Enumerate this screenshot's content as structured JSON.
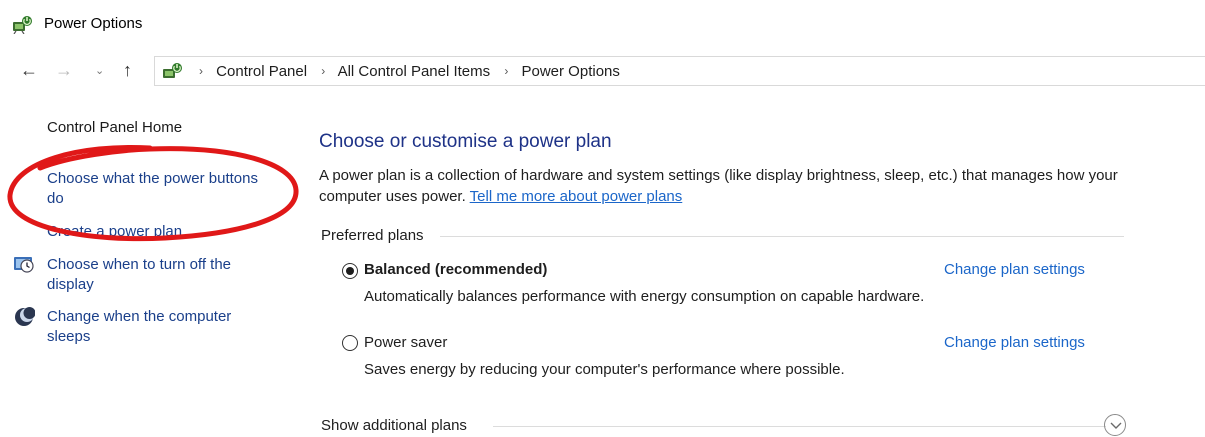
{
  "window": {
    "title": "Power Options",
    "icon": "power-options-icon"
  },
  "navigation": {
    "back_icon": "←",
    "forward_icon": "→",
    "recent_icon": "⌄",
    "up_icon": "↑",
    "separator": "›",
    "breadcrumbs": [
      "Control Panel",
      "All Control Panel Items",
      "Power Options"
    ]
  },
  "sidebar": {
    "home": "Control Panel Home",
    "items": [
      {
        "label": "Choose what the power buttons do"
      },
      {
        "label": "Create a power plan"
      },
      {
        "label": "Choose when to turn off the display",
        "icon": "display-timer-icon"
      },
      {
        "label": "Change when the computer sleeps",
        "icon": "moon-sleep-icon"
      }
    ]
  },
  "main": {
    "title": "Choose or customise a power plan",
    "description": "A power plan is a collection of hardware and system settings (like display brightness, sleep, etc.) that manages how your computer uses power.",
    "description_link": "Tell me more about power plans",
    "preferred_label": "Preferred plans",
    "plans": [
      {
        "name": "Balanced (recommended)",
        "selected": true,
        "description": "Automatically balances performance with energy consumption on capable hardware.",
        "link": "Change plan settings"
      },
      {
        "name": "Power saver",
        "selected": false,
        "description": "Saves energy by reducing your computer's performance where possible.",
        "link": "Change plan settings"
      }
    ],
    "more_label": "Show additional plans"
  },
  "colors": {
    "heading": "#1e3287",
    "link": "#1b66c9",
    "annotation": "#e01818"
  }
}
